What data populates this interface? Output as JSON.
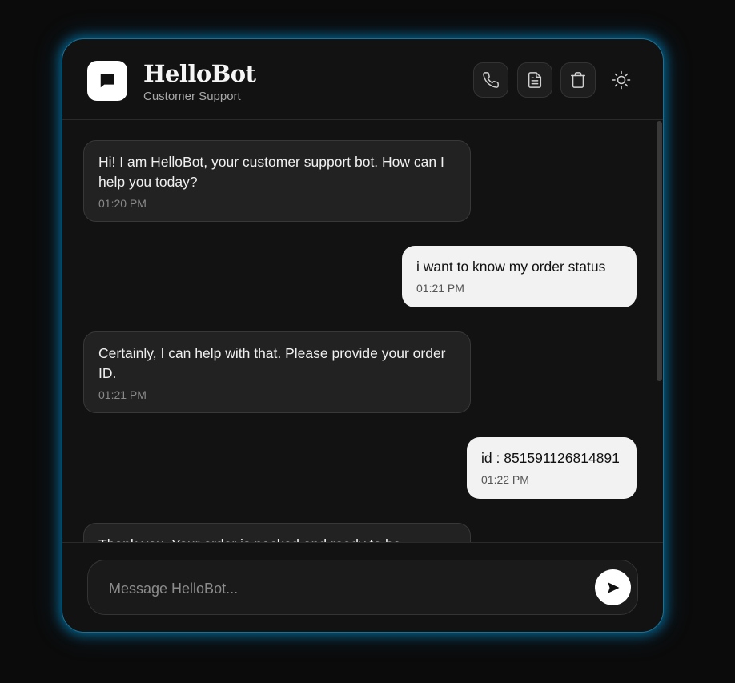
{
  "app": {
    "title": "HelloBot",
    "subtitle": "Customer Support"
  },
  "header_actions": [
    {
      "name": "call",
      "icon": "phone-icon"
    },
    {
      "name": "transcript",
      "icon": "document-icon"
    },
    {
      "name": "clear",
      "icon": "trash-icon"
    },
    {
      "name": "theme",
      "icon": "sun-icon"
    }
  ],
  "messages": [
    {
      "role": "bot",
      "text": "Hi! I am HelloBot, your customer support bot. How can I help you today?",
      "time": "01:20 PM"
    },
    {
      "role": "user",
      "text": "i want to know my order status",
      "time": "01:21 PM"
    },
    {
      "role": "bot",
      "text": "Certainly, I can help with that. Please provide your order ID.",
      "time": "01:21 PM"
    },
    {
      "role": "user",
      "text": "id : 851591126814891",
      "time": "01:22 PM"
    },
    {
      "role": "bot",
      "text": "Thank you. Your order is packed and ready to be",
      "time": ""
    }
  ],
  "composer": {
    "placeholder": "Message HelloBot...",
    "send_icon": "send-icon"
  },
  "colors": {
    "accent_glow": "#1f9fe0",
    "background": "#0b0b0b",
    "panel": "#121212",
    "bot_bubble": "#222222",
    "user_bubble": "#f2f2f2"
  }
}
